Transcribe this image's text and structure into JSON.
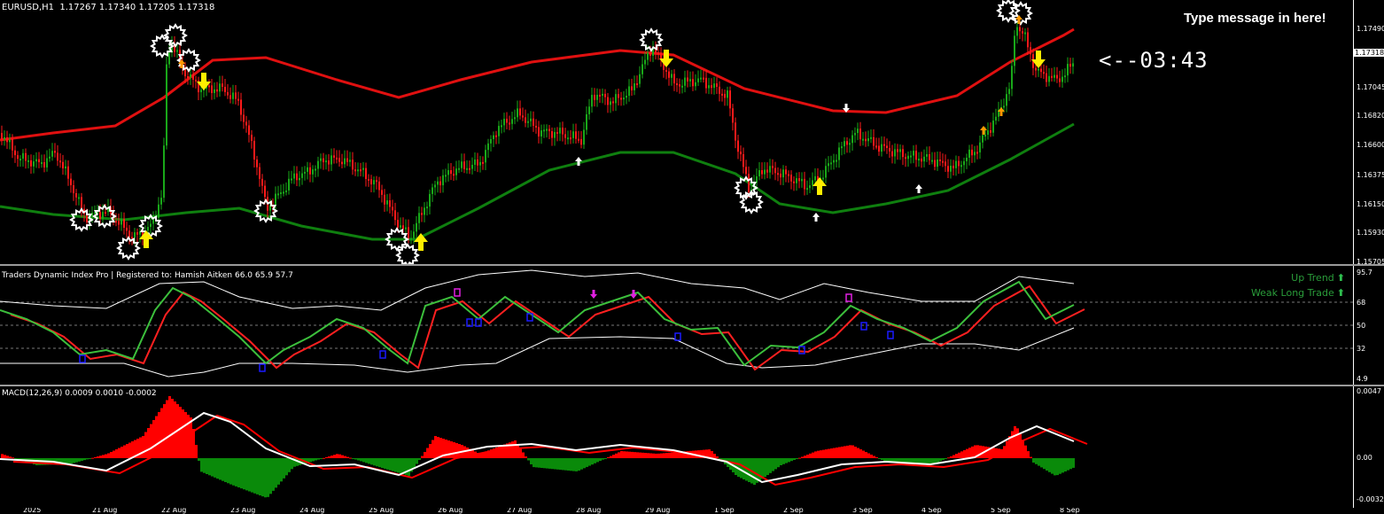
{
  "chart_header": {
    "symbol_timeframe": "EURUSD,H1",
    "ohlc": "1.17267 1.17340 1.17205 1.17318"
  },
  "overlay": {
    "message": "Type message in here!",
    "countdown": "<--03:43"
  },
  "price_scale": {
    "ticks": [
      "1.17490",
      "1.17045",
      "1.16820",
      "1.16600",
      "1.16375",
      "1.16150",
      "1.15930",
      "1.15705"
    ],
    "current_price": "1.17318"
  },
  "tdi_panel": {
    "title": "Traders Dynamic Index Pro | Registered to: Hamish Aitken 66.0 65.9 57.7",
    "legend": [
      {
        "label": "Up Trend",
        "icon": "up-arrow-icon"
      },
      {
        "label": "Weak Long Trade",
        "icon": "up-arrow-icon"
      }
    ],
    "scale_ticks": [
      "95.7",
      "68",
      "50",
      "32",
      "4.9"
    ],
    "colors": {
      "rsi": "#3cbf3c",
      "signal": "#ff2020",
      "bands": "#ffffff",
      "up_signal": "#1a1aff",
      "down_signal": "#e020e0"
    }
  },
  "macd_panel": {
    "title": "MACD(12,26,9) 0.0009 0.0010 -0.0002",
    "scale_ticks": [
      "0.0047",
      "0.00",
      "-0.0032"
    ],
    "colors": {
      "positive": "#ff0000",
      "negative": "#0a8a0a",
      "main": "#ffffff",
      "signal": "#ff0000"
    }
  },
  "main_colors": {
    "bull_candle": "#19a819",
    "bear_candle": "#ff1a1a",
    "upper_band": "#e01010",
    "lower_band": "#0f7f0f",
    "buy_arrow": "#ffee00",
    "sell_arrow": "#ffee00"
  },
  "time_axis": {
    "labels": [
      "2025",
      "21 Aug",
      "22 Aug",
      "23 Aug",
      "24 Aug",
      "25 Aug",
      "26 Aug",
      "27 Aug",
      "28 Aug",
      "29 Aug",
      "1 Sep",
      "2 Sep",
      "3 Sep",
      "4 Sep",
      "5 Sep",
      "8 Sep"
    ]
  }
}
